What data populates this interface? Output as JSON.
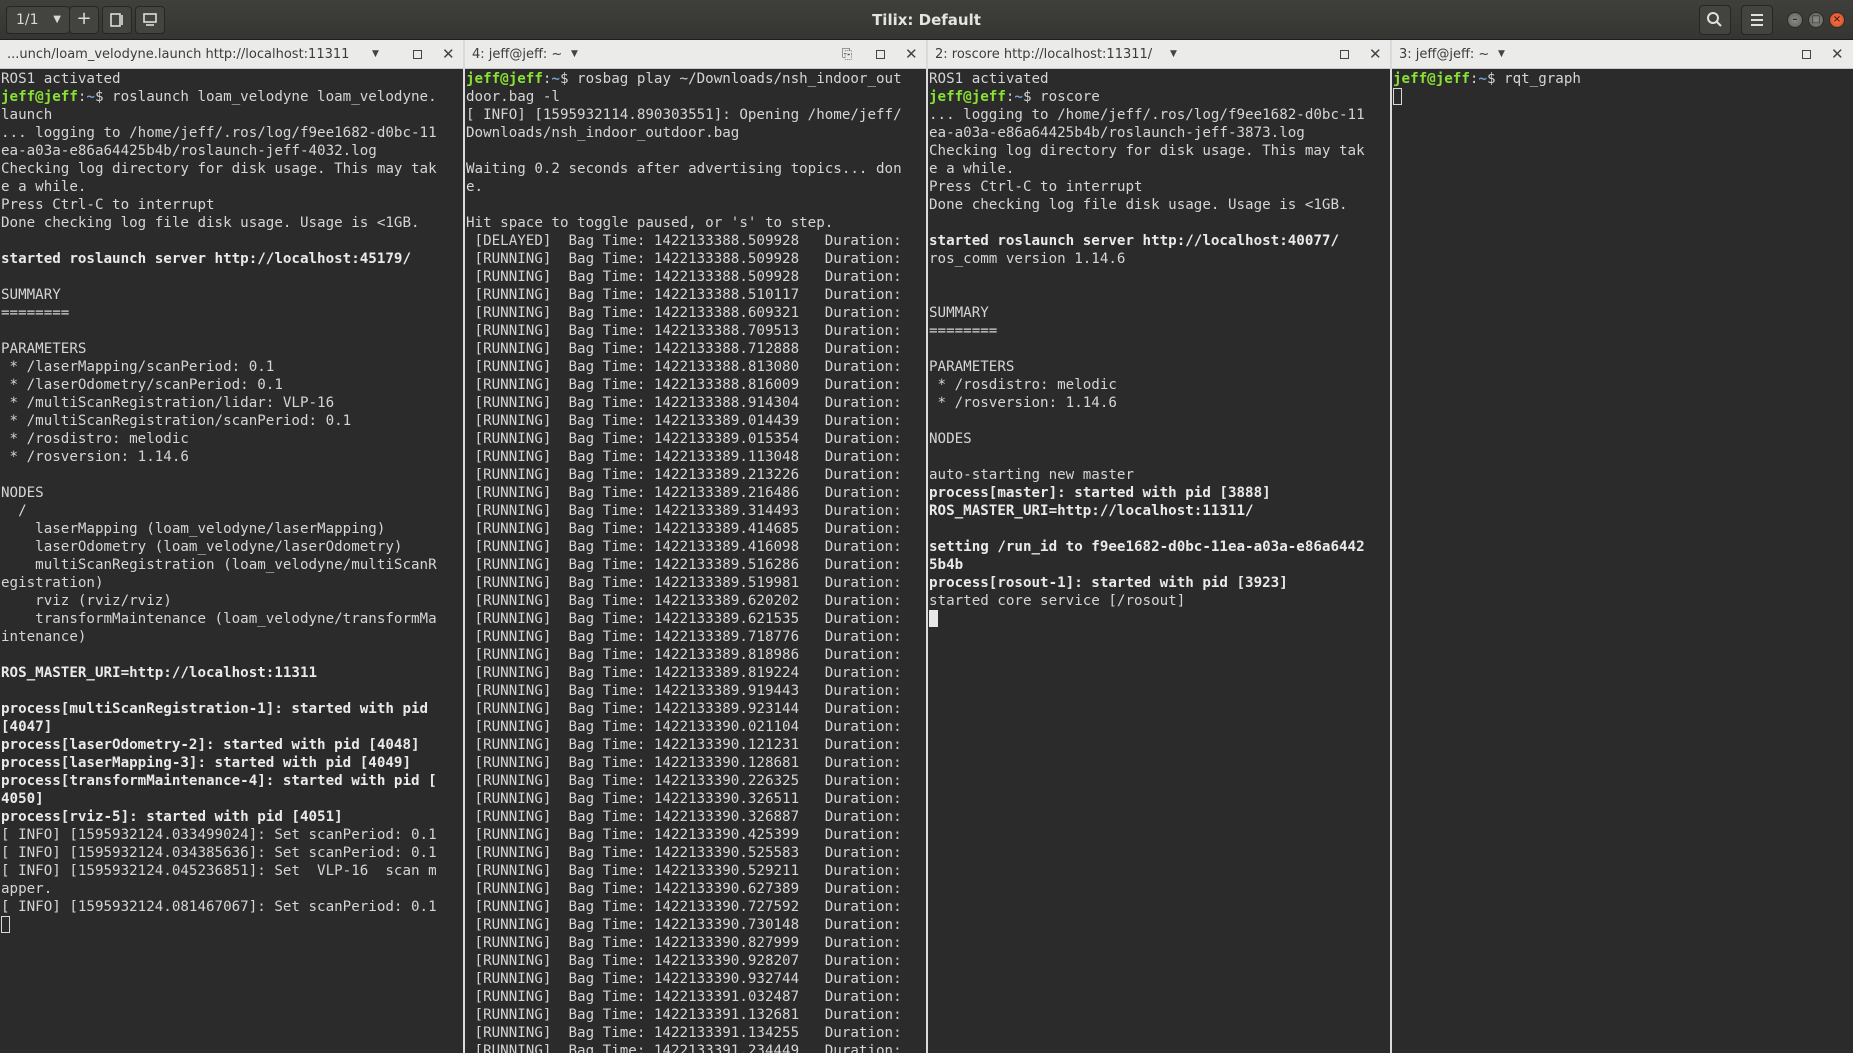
{
  "window": {
    "title": "Tilix: Default",
    "session_label": "1/1"
  },
  "panes": [
    {
      "title": "...unch/loam_velodyne.launch http://localhost:11311",
      "lines": [
        [
          [
            "ROS1 activated",
            ""
          ]
        ],
        [
          [
            "jeff@jeff",
            "usr"
          ],
          [
            ":",
            ""
          ],
          [
            "~",
            "pth"
          ],
          [
            "$ roslaunch loam_velodyne loam_velodyne.",
            ""
          ]
        ],
        [
          [
            "launch",
            ""
          ]
        ],
        [
          [
            "... logging to /home/jeff/.ros/log/f9ee1682-d0bc-11",
            ""
          ]
        ],
        [
          [
            "ea-a03a-e86a64425b4b/roslaunch-jeff-4032.log",
            ""
          ]
        ],
        [
          [
            "Checking log directory for disk usage. This may tak",
            ""
          ]
        ],
        [
          [
            "e a while.",
            ""
          ]
        ],
        [
          [
            "Press Ctrl-C to interrupt",
            ""
          ]
        ],
        [
          [
            "Done checking log file disk usage. Usage is <1GB.",
            ""
          ]
        ],
        [],
        [
          [
            "started roslaunch server http://localhost:45179/",
            "b"
          ]
        ],
        [],
        [
          [
            "SUMMARY",
            ""
          ]
        ],
        [
          [
            "========",
            ""
          ]
        ],
        [],
        [
          [
            "PARAMETERS",
            ""
          ]
        ],
        [
          [
            " * /laserMapping/scanPeriod: 0.1",
            ""
          ]
        ],
        [
          [
            " * /laserOdometry/scanPeriod: 0.1",
            ""
          ]
        ],
        [
          [
            " * /multiScanRegistration/lidar: VLP-16",
            ""
          ]
        ],
        [
          [
            " * /multiScanRegistration/scanPeriod: 0.1",
            ""
          ]
        ],
        [
          [
            " * /rosdistro: melodic",
            ""
          ]
        ],
        [
          [
            " * /rosversion: 1.14.6",
            ""
          ]
        ],
        [],
        [
          [
            "NODES",
            ""
          ]
        ],
        [
          [
            "  /",
            ""
          ]
        ],
        [
          [
            "    laserMapping (loam_velodyne/laserMapping)",
            ""
          ]
        ],
        [
          [
            "    laserOdometry (loam_velodyne/laserOdometry)",
            ""
          ]
        ],
        [
          [
            "    multiScanRegistration (loam_velodyne/multiScanR",
            ""
          ]
        ],
        [
          [
            "egistration)",
            ""
          ]
        ],
        [
          [
            "    rviz (rviz/rviz)",
            ""
          ]
        ],
        [
          [
            "    transformMaintenance (loam_velodyne/transformMa",
            ""
          ]
        ],
        [
          [
            "intenance)",
            ""
          ]
        ],
        [],
        [
          [
            "ROS_MASTER_URI=http://localhost:11311",
            "b"
          ]
        ],
        [],
        [
          [
            "process[multiScanRegistration-1]: started with pid",
            "b"
          ]
        ],
        [
          [
            "[4047]",
            "b"
          ]
        ],
        [
          [
            "process[laserOdometry-2]: started with pid [4048]",
            "b"
          ]
        ],
        [
          [
            "process[laserMapping-3]: started with pid [4049]",
            "b"
          ]
        ],
        [
          [
            "process[transformMaintenance-4]: started with pid [",
            "b"
          ]
        ],
        [
          [
            "4050]",
            "b"
          ]
        ],
        [
          [
            "process[rviz-5]: started with pid [4051]",
            "b"
          ]
        ],
        [
          [
            "[ INFO] [1595932124.033499024]: Set scanPeriod: 0.1",
            ""
          ]
        ],
        [
          [
            "[ INFO] [1595932124.034385636]: Set scanPeriod: 0.1",
            ""
          ]
        ],
        [
          [
            "[ INFO] [1595932124.045236851]: Set  VLP-16  scan m",
            ""
          ]
        ],
        [
          [
            "apper.",
            ""
          ]
        ],
        [
          [
            "[ INFO] [1595932124.081467067]: Set scanPeriod: 0.1",
            ""
          ]
        ]
      ]
    },
    {
      "title": "4: jeff@jeff: ~",
      "lines": [
        [
          [
            "jeff@jeff",
            "usr"
          ],
          [
            ":",
            ""
          ],
          [
            "~",
            "pth"
          ],
          [
            "$ rosbag play ~/Downloads/nsh_indoor_out",
            ""
          ]
        ],
        [
          [
            "door.bag -l",
            ""
          ]
        ],
        [
          [
            "[ INFO] [1595932114.890303551]: Opening /home/jeff/",
            ""
          ]
        ],
        [
          [
            "Downloads/nsh_indoor_outdoor.bag",
            ""
          ]
        ],
        [],
        [
          [
            "Waiting 0.2 seconds after advertising topics... don",
            ""
          ]
        ],
        [
          [
            "e.",
            ""
          ]
        ],
        [],
        [
          [
            "Hit space to toggle paused, or 's' to step.",
            ""
          ]
        ],
        [
          [
            " [DELAYED]  Bag Time: 1422133388.509928   Duration:",
            ""
          ]
        ],
        [
          [
            " [RUNNING]  Bag Time: 1422133388.509928   Duration:",
            ""
          ]
        ],
        [
          [
            " [RUNNING]  Bag Time: 1422133388.509928   Duration:",
            ""
          ]
        ],
        [
          [
            " [RUNNING]  Bag Time: 1422133388.510117   Duration:",
            ""
          ]
        ],
        [
          [
            " [RUNNING]  Bag Time: 1422133388.609321   Duration:",
            ""
          ]
        ],
        [
          [
            " [RUNNING]  Bag Time: 1422133388.709513   Duration:",
            ""
          ]
        ],
        [
          [
            " [RUNNING]  Bag Time: 1422133388.712888   Duration:",
            ""
          ]
        ],
        [
          [
            " [RUNNING]  Bag Time: 1422133388.813080   Duration:",
            ""
          ]
        ],
        [
          [
            " [RUNNING]  Bag Time: 1422133388.816009   Duration:",
            ""
          ]
        ],
        [
          [
            " [RUNNING]  Bag Time: 1422133388.914304   Duration:",
            ""
          ]
        ],
        [
          [
            " [RUNNING]  Bag Time: 1422133389.014439   Duration:",
            ""
          ]
        ],
        [
          [
            " [RUNNING]  Bag Time: 1422133389.015354   Duration:",
            ""
          ]
        ],
        [
          [
            " [RUNNING]  Bag Time: 1422133389.113048   Duration:",
            ""
          ]
        ],
        [
          [
            " [RUNNING]  Bag Time: 1422133389.213226   Duration:",
            ""
          ]
        ],
        [
          [
            " [RUNNING]  Bag Time: 1422133389.216486   Duration:",
            ""
          ]
        ],
        [
          [
            " [RUNNING]  Bag Time: 1422133389.314493   Duration:",
            ""
          ]
        ],
        [
          [
            " [RUNNING]  Bag Time: 1422133389.414685   Duration:",
            ""
          ]
        ],
        [
          [
            " [RUNNING]  Bag Time: 1422133389.416098   Duration:",
            ""
          ]
        ],
        [
          [
            " [RUNNING]  Bag Time: 1422133389.516286   Duration:",
            ""
          ]
        ],
        [
          [
            " [RUNNING]  Bag Time: 1422133389.519981   Duration:",
            ""
          ]
        ],
        [
          [
            " [RUNNING]  Bag Time: 1422133389.620202   Duration:",
            ""
          ]
        ],
        [
          [
            " [RUNNING]  Bag Time: 1422133389.621535   Duration:",
            ""
          ]
        ],
        [
          [
            " [RUNNING]  Bag Time: 1422133389.718776   Duration:",
            ""
          ]
        ],
        [
          [
            " [RUNNING]  Bag Time: 1422133389.818986   Duration:",
            ""
          ]
        ],
        [
          [
            " [RUNNING]  Bag Time: 1422133389.819224   Duration:",
            ""
          ]
        ],
        [
          [
            " [RUNNING]  Bag Time: 1422133389.919443   Duration:",
            ""
          ]
        ],
        [
          [
            " [RUNNING]  Bag Time: 1422133389.923144   Duration:",
            ""
          ]
        ],
        [
          [
            " [RUNNING]  Bag Time: 1422133390.021104   Duration:",
            ""
          ]
        ],
        [
          [
            " [RUNNING]  Bag Time: 1422133390.121231   Duration:",
            ""
          ]
        ],
        [
          [
            " [RUNNING]  Bag Time: 1422133390.128681   Duration:",
            ""
          ]
        ],
        [
          [
            " [RUNNING]  Bag Time: 1422133390.226325   Duration:",
            ""
          ]
        ],
        [
          [
            " [RUNNING]  Bag Time: 1422133390.326511   Duration:",
            ""
          ]
        ],
        [
          [
            " [RUNNING]  Bag Time: 1422133390.326887   Duration:",
            ""
          ]
        ],
        [
          [
            " [RUNNING]  Bag Time: 1422133390.425399   Duration:",
            ""
          ]
        ],
        [
          [
            " [RUNNING]  Bag Time: 1422133390.525583   Duration:",
            ""
          ]
        ],
        [
          [
            " [RUNNING]  Bag Time: 1422133390.529211   Duration:",
            ""
          ]
        ],
        [
          [
            " [RUNNING]  Bag Time: 1422133390.627389   Duration:",
            ""
          ]
        ],
        [
          [
            " [RUNNING]  Bag Time: 1422133390.727592   Duration:",
            ""
          ]
        ],
        [
          [
            " [RUNNING]  Bag Time: 1422133390.730148   Duration:",
            ""
          ]
        ],
        [
          [
            " [RUNNING]  Bag Time: 1422133390.827999   Duration:",
            ""
          ]
        ],
        [
          [
            " [RUNNING]  Bag Time: 1422133390.928207   Duration:",
            ""
          ]
        ],
        [
          [
            " [RUNNING]  Bag Time: 1422133390.932744   Duration:",
            ""
          ]
        ],
        [
          [
            " [RUNNING]  Bag Time: 1422133391.032487   Duration:",
            ""
          ]
        ],
        [
          [
            " [RUNNING]  Bag Time: 1422133391.132681   Duration:",
            ""
          ]
        ],
        [
          [
            " [RUNNING]  Bag Time: 1422133391.134255   Duration:",
            ""
          ]
        ],
        [
          [
            " [RUNNING]  Bag Time: 1422133391.234449   Duration:",
            ""
          ]
        ]
      ]
    },
    {
      "title": "2: roscore http://localhost:11311/",
      "lines": [
        [
          [
            "ROS1 activated",
            ""
          ]
        ],
        [
          [
            "jeff@jeff",
            "usr"
          ],
          [
            ":",
            ""
          ],
          [
            "~",
            "pth"
          ],
          [
            "$ roscore",
            ""
          ]
        ],
        [
          [
            "... logging to /home/jeff/.ros/log/f9ee1682-d0bc-11",
            ""
          ]
        ],
        [
          [
            "ea-a03a-e86a64425b4b/roslaunch-jeff-3873.log",
            ""
          ]
        ],
        [
          [
            "Checking log directory for disk usage. This may tak",
            ""
          ]
        ],
        [
          [
            "e a while.",
            ""
          ]
        ],
        [
          [
            "Press Ctrl-C to interrupt",
            ""
          ]
        ],
        [
          [
            "Done checking log file disk usage. Usage is <1GB.",
            ""
          ]
        ],
        [],
        [
          [
            "started roslaunch server http://localhost:40077/",
            "b"
          ]
        ],
        [
          [
            "ros_comm version 1.14.6",
            ""
          ]
        ],
        [],
        [],
        [
          [
            "SUMMARY",
            ""
          ]
        ],
        [
          [
            "========",
            ""
          ]
        ],
        [],
        [
          [
            "PARAMETERS",
            ""
          ]
        ],
        [
          [
            " * /rosdistro: melodic",
            ""
          ]
        ],
        [
          [
            " * /rosversion: 1.14.6",
            ""
          ]
        ],
        [],
        [
          [
            "NODES",
            ""
          ]
        ],
        [],
        [
          [
            "auto-starting new master",
            ""
          ]
        ],
        [
          [
            "process[master]: started with pid [3888]",
            "b"
          ]
        ],
        [
          [
            "ROS_MASTER_URI=http://localhost:11311/",
            "b"
          ]
        ],
        [],
        [
          [
            "setting /run_id to f9ee1682-d0bc-11ea-a03a-e86a6442",
            "b"
          ]
        ],
        [
          [
            "5b4b",
            "b"
          ]
        ],
        [
          [
            "process[rosout-1]: started with pid [3923]",
            "b"
          ]
        ],
        [
          [
            "started core service [/rosout]",
            ""
          ]
        ]
      ]
    },
    {
      "title": "3: jeff@jeff: ~",
      "lines": [
        [
          [
            "jeff@jeff",
            "usr"
          ],
          [
            ":",
            ""
          ],
          [
            "~",
            "pth"
          ],
          [
            "$ rqt_graph",
            ""
          ]
        ]
      ]
    }
  ]
}
